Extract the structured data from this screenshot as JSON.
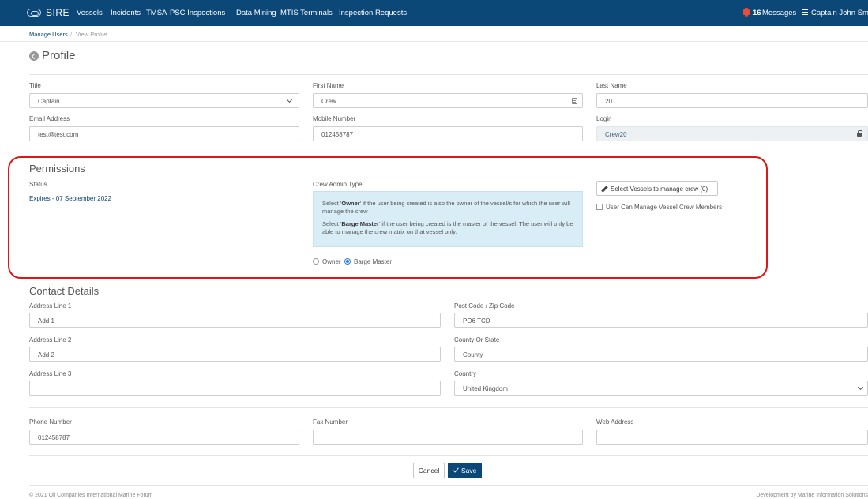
{
  "navbar": {
    "brand": "SIRE",
    "links": [
      "Vessels",
      "Incidents",
      "TMSA",
      "PSC Inspections",
      "Data Mining",
      "MTIS Terminals",
      "Inspection Requests"
    ],
    "messages_count": "16",
    "messages_label": "Messages",
    "user_name": "Captain John Smith"
  },
  "breadcrumb": {
    "manage_users": "Manage Users",
    "separator": "/",
    "view_profile": "View Profile"
  },
  "page": {
    "title": "Profile"
  },
  "profile": {
    "title_label": "Title",
    "title_value": "Captain",
    "first_name_label": "First Name",
    "first_name_value": "Crew",
    "last_name_label": "Last Name",
    "last_name_value": "20",
    "email_label": "Email Address",
    "email_value": "test@test.com",
    "mobile_label": "Mobile Number",
    "mobile_value": "012458787",
    "login_label": "Login",
    "login_value": "Crew20"
  },
  "permissions": {
    "heading": "Permissions",
    "status_label": "Status",
    "status_value": "Expires - 07 September 2022",
    "crew_admin_label": "Crew Admin Type",
    "info_owner_pre": "Select '",
    "info_owner_bold": "Owner",
    "info_owner_post": "' if the user being created is also the owner of the vessel/s for which the user will manage the crew",
    "info_barge_pre": "Select '",
    "info_barge_bold": "Barge Master",
    "info_barge_post": "' if the user being created is the master of the vessel. The user will only be able to manage the crew matrix on that vessel only.",
    "radio_owner": "Owner",
    "radio_barge": "Barge Master",
    "select_vessels_btn": "Select Vessels to manage crew (0)",
    "manage_crew_checkbox": "User Can Manage Vessel Crew Members"
  },
  "contact": {
    "heading": "Contact Details",
    "address1_label": "Address Line 1",
    "address1_value": "Add 1",
    "address2_label": "Address Line 2",
    "address2_value": "Add 2",
    "address3_label": "Address Line 3",
    "address3_value": "",
    "postcode_label": "Post Code / Zip Code",
    "postcode_value": "PO6 TCD",
    "county_label": "County Or State",
    "county_value": "County",
    "country_label": "Country",
    "country_value": "United Kingdom",
    "phone_label": "Phone Number",
    "phone_value": "012458787",
    "fax_label": "Fax Number",
    "fax_value": "",
    "web_label": "Web Address",
    "web_value": ""
  },
  "actions": {
    "cancel": "Cancel",
    "save": "Save"
  },
  "footer": {
    "copyright": "© 2021 Oil Companies International Marine Forum",
    "developer": "Development by Marine Information Solutions"
  },
  "colors": {
    "navbar": "#0b4777",
    "info_box": "#d9edf7",
    "highlight": "#e21414",
    "save_button": "#0b4777"
  }
}
